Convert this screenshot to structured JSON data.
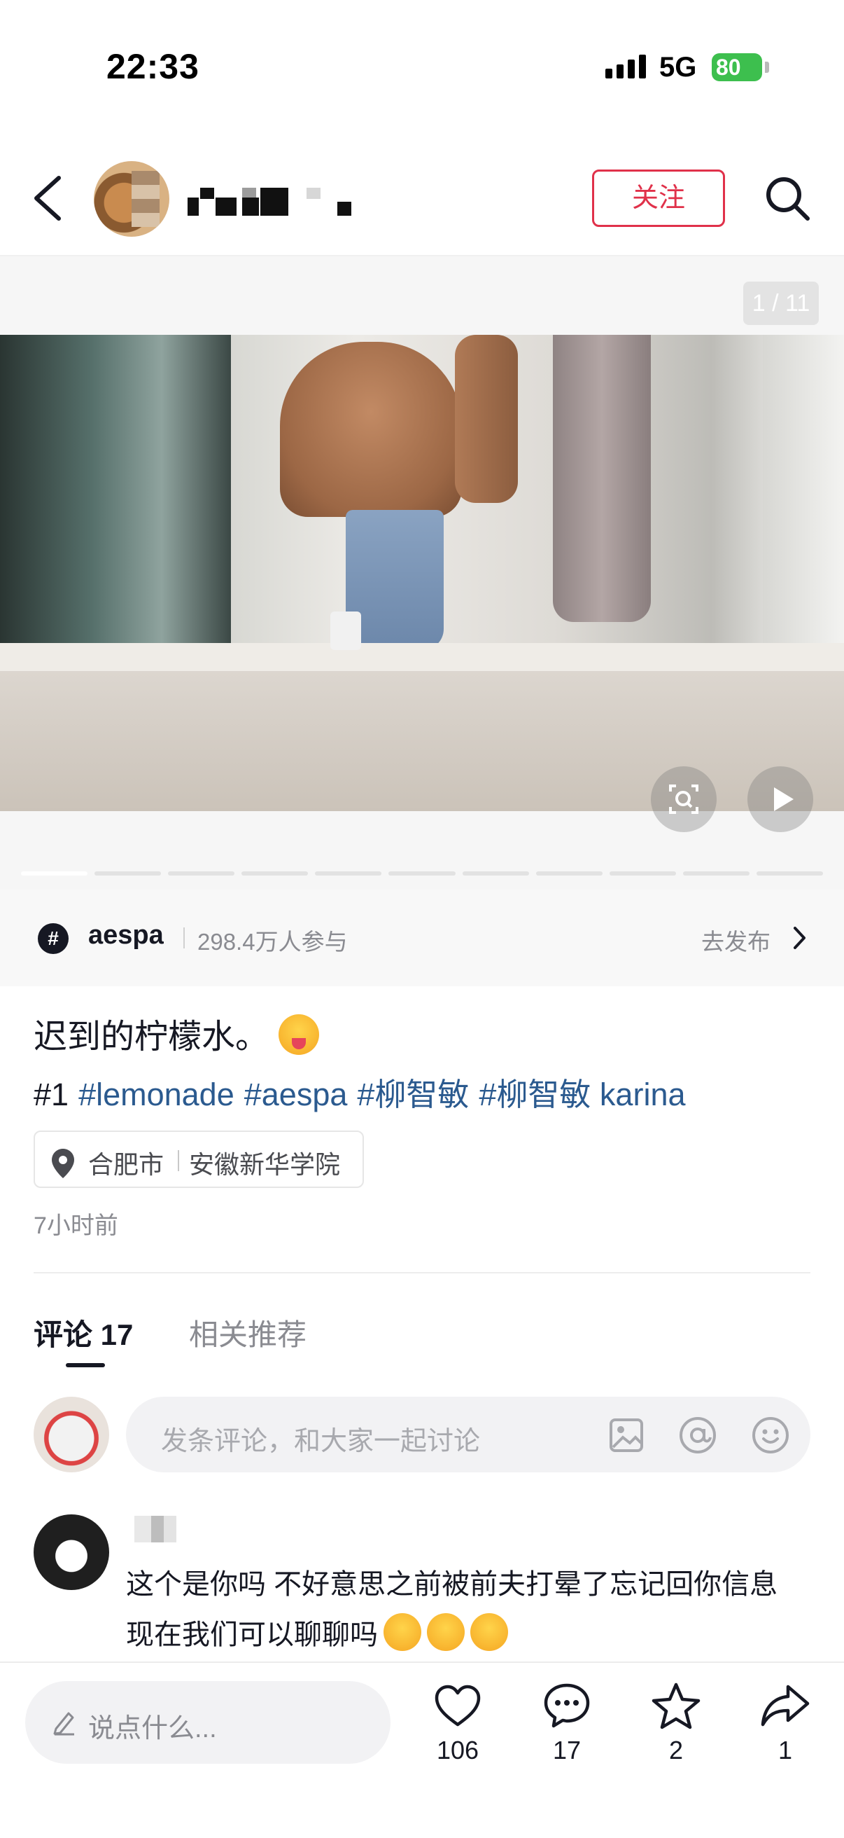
{
  "status_bar": {
    "time": "22:33",
    "network": "5G",
    "battery": "80"
  },
  "header": {
    "follow_label": "关注"
  },
  "gallery": {
    "counter": "1 / 11",
    "total": 11,
    "current": 1
  },
  "topic": {
    "icon": "#",
    "name": "aespa",
    "participants": "298.4万人参与",
    "publish": "去发布"
  },
  "post": {
    "caption": "迟到的柠檬水。",
    "tags": [
      {
        "text": "#1",
        "link": false
      },
      {
        "text": "#lemonade",
        "link": true
      },
      {
        "text": "#aespa",
        "link": true
      },
      {
        "text": "#柳智敏",
        "link": true
      },
      {
        "text": "#柳智敏 karina",
        "link": true
      }
    ],
    "location": {
      "city": "合肥市",
      "place": "安徽新华学院"
    },
    "time_ago": "7小时前"
  },
  "tabs": {
    "comments": "评论 17",
    "related": "相关推荐"
  },
  "comment_input": {
    "placeholder": "发条评论，和大家一起讨论"
  },
  "comments": [
    {
      "text": "这个是你吗 不好意思之前被前夫打晕了忘记回你信息 现在我们可以聊聊吗"
    }
  ],
  "bottom_bar": {
    "say_placeholder": "说点什么...",
    "like_count": "106",
    "comment_count": "17",
    "fav_count": "2",
    "share_count": "1"
  },
  "colors": {
    "accent": "#e0314a",
    "link": "#2b5a8f",
    "battery": "#3dbf4e"
  }
}
